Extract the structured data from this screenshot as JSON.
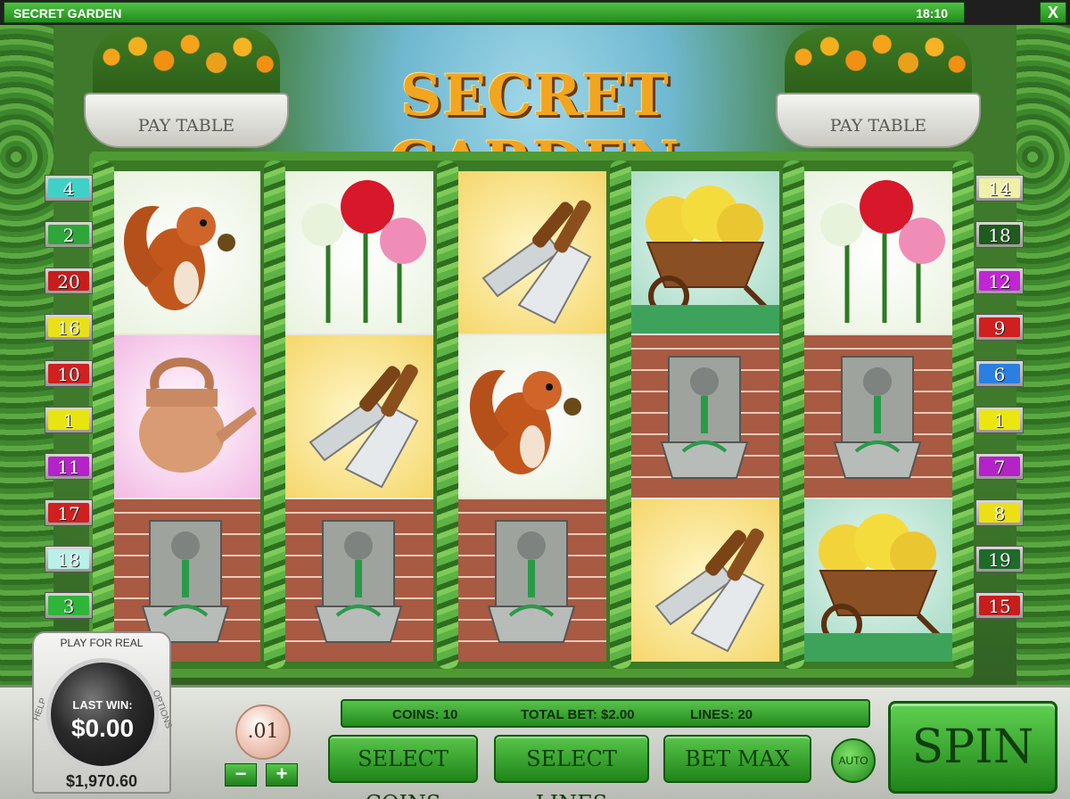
{
  "window": {
    "title": "SECRET GARDEN",
    "clock": "18:10",
    "close_label": "X"
  },
  "game": {
    "logo": "SECRET GARDEN",
    "pay_table_label": "PAY TABLE"
  },
  "reels": [
    [
      "squirrel",
      "watering-can",
      "fountain"
    ],
    [
      "roses",
      "garden-tools",
      "fountain"
    ],
    [
      "garden-tools",
      "squirrel",
      "fountain"
    ],
    [
      "wheelbarrow",
      "fountain",
      "garden-tools"
    ],
    [
      "roses",
      "fountain",
      "wheelbarrow"
    ]
  ],
  "paylines": {
    "left": [
      {
        "num": "4",
        "color": "#3fd1c7"
      },
      {
        "num": "2",
        "color": "#2fa63a"
      },
      {
        "num": "20",
        "color": "#c81d1d"
      },
      {
        "num": "16",
        "color": "#e8e11a"
      },
      {
        "num": "10",
        "color": "#d0201f"
      },
      {
        "num": "1",
        "color": "#e8e40f"
      },
      {
        "num": "11",
        "color": "#b323c8"
      },
      {
        "num": "17",
        "color": "#d11f1f"
      },
      {
        "num": "18",
        "color": "#b9f0e8"
      },
      {
        "num": "3",
        "color": "#2fb53a"
      }
    ],
    "right": [
      {
        "num": "14",
        "color": "#f0f0a8"
      },
      {
        "num": "18",
        "color": "#1f5a1f"
      },
      {
        "num": "12",
        "color": "#c125d4"
      },
      {
        "num": "9",
        "color": "#d01f1f"
      },
      {
        "num": "6",
        "color": "#2a7fe0"
      },
      {
        "num": "1",
        "color": "#ebe60f"
      },
      {
        "num": "7",
        "color": "#b323c8"
      },
      {
        "num": "8",
        "color": "#ecdf14"
      },
      {
        "num": "19",
        "color": "#1f6a2a"
      },
      {
        "num": "15",
        "color": "#c81d1d"
      }
    ]
  },
  "badge": {
    "play_for_real": "PLAY FOR REAL",
    "last_win_label": "LAST WIN:",
    "last_win_value": "$0.00",
    "help": "HELP",
    "options": "OPTIONS",
    "balance": "$1,970.60"
  },
  "controls": {
    "coin_value": ".01",
    "minus": "−",
    "plus": "+",
    "coins_text": "COINS: 10",
    "total_bet_text": "TOTAL BET: $2.00",
    "lines_text": "LINES: 20",
    "select_coins": "SELECT COINS",
    "select_lines": "SELECT LINES",
    "bet_max": "BET MAX",
    "auto": "AUTO",
    "spin": "SPIN"
  }
}
